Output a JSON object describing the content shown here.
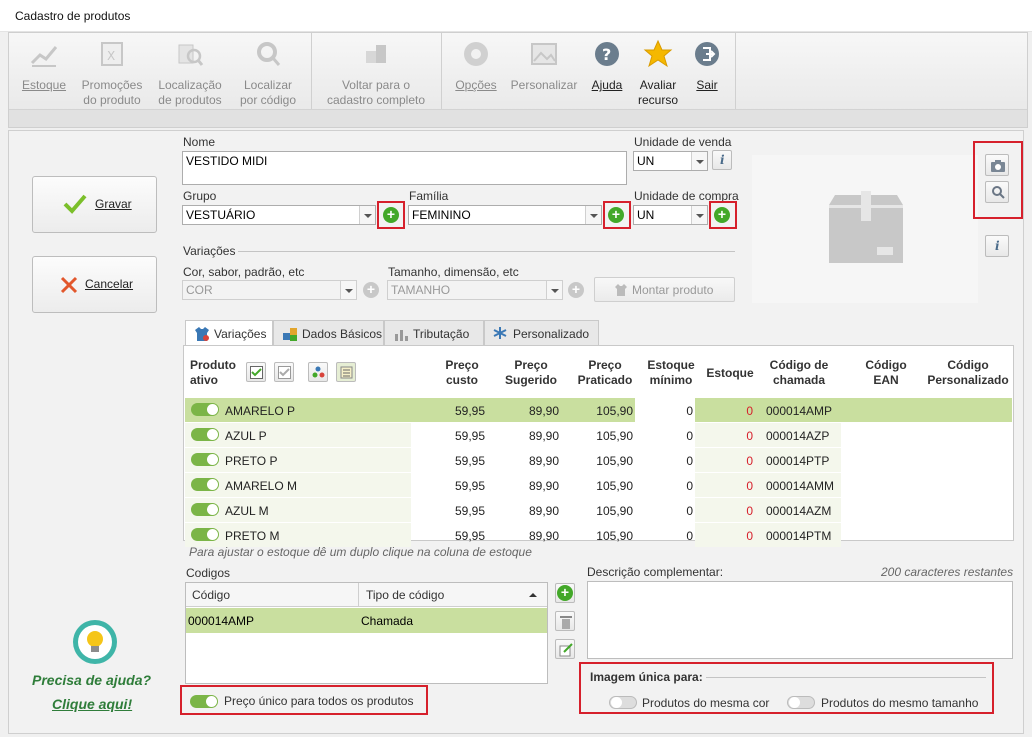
{
  "window": {
    "title": "Cadastro de produtos"
  },
  "toolbar": {
    "estoque": "Estoque",
    "promocoes_1": "Promoções",
    "promocoes_2": "do produto",
    "localizacao_1": "Localização",
    "localizacao_2": "de produtos",
    "localizar_1": "Localizar",
    "localizar_2": "por código",
    "voltar_1": "Voltar para o",
    "voltar_2": "cadastro completo",
    "opcoes": "Opções",
    "personalizar": "Personalizar",
    "ajuda": "Ajuda",
    "avaliar_1": "Avaliar",
    "avaliar_2": "recurso",
    "sair": "Sair"
  },
  "actions": {
    "gravar": "Gravar",
    "cancelar": "Cancelar"
  },
  "form": {
    "nome_label": "Nome",
    "nome_value": "VESTIDO MIDI",
    "unidade_venda_label": "Unidade de venda",
    "unidade_venda_value": "UN",
    "grupo_label": "Grupo",
    "grupo_value": "VESTUÁRIO",
    "familia_label": "Família",
    "familia_value": "FEMININO",
    "unidade_compra_label": "Unidade de compra",
    "unidade_compra_value": "UN",
    "variacoes_label": "Variações",
    "cor_label": "Cor, sabor, padrão, etc",
    "cor_value": "COR",
    "tamanho_label": "Tamanho, dimensão, etc",
    "tamanho_value": "TAMANHO",
    "montar_label": "Montar produto"
  },
  "tabs": [
    "Variações",
    "Dados Básicos",
    "Tributação",
    "Personalizado"
  ],
  "grid": {
    "headers": {
      "produto_1": "Produto",
      "produto_2": "ativo",
      "custo_1": "Preço",
      "custo_2": "custo",
      "sugerido_1": "Preço",
      "sugerido_2": "Sugerido",
      "praticado_1": "Preço",
      "praticado_2": "Praticado",
      "minimo_1": "Estoque",
      "minimo_2": "mínimo",
      "estoque": "Estoque",
      "chamada_1": "Código de",
      "chamada_2": "chamada",
      "ean_1": "Código",
      "ean_2": "EAN",
      "pers_1": "Código",
      "pers_2": "Personalizado"
    },
    "rows": [
      {
        "name": "AMARELO P",
        "custo": "59,95",
        "sugerido": "89,90",
        "praticado": "105,90",
        "minimo": "0",
        "estoque": "0",
        "codigo": "000014AMP"
      },
      {
        "name": "AZUL P",
        "custo": "59,95",
        "sugerido": "89,90",
        "praticado": "105,90",
        "minimo": "0",
        "estoque": "0",
        "codigo": "000014AZP"
      },
      {
        "name": "PRETO P",
        "custo": "59,95",
        "sugerido": "89,90",
        "praticado": "105,90",
        "minimo": "0",
        "estoque": "0",
        "codigo": "000014PTP"
      },
      {
        "name": "AMARELO M",
        "custo": "59,95",
        "sugerido": "89,90",
        "praticado": "105,90",
        "minimo": "0",
        "estoque": "0",
        "codigo": "000014AMM"
      },
      {
        "name": "AZUL M",
        "custo": "59,95",
        "sugerido": "89,90",
        "praticado": "105,90",
        "minimo": "0",
        "estoque": "0",
        "codigo": "000014AZM"
      },
      {
        "name": "PRETO M",
        "custo": "59,95",
        "sugerido": "89,90",
        "praticado": "105,90",
        "minimo": "0",
        "estoque": "0",
        "codigo": "000014PTM"
      }
    ],
    "hint": "Para ajustar o estoque dê um duplo clique na coluna de estoque"
  },
  "codigos": {
    "label": "Codigos",
    "col_codigo": "Código",
    "col_tipo": "Tipo de código",
    "row_codigo": "000014AMP",
    "row_tipo": "Chamada"
  },
  "descricao": {
    "label": "Descrição complementar:",
    "remaining": "200  caracteres restantes"
  },
  "preco_unico": "Preço único para todos os produtos",
  "imagem": {
    "title": "Imagem única para:",
    "mesma_cor": "Produtos do mesma cor",
    "mesmo_tamanho": "Produtos do mesmo tamanho"
  },
  "help": {
    "line1": "Precisa de ajuda?",
    "line2": "Clique aqui!"
  },
  "colors": {
    "accent_green": "#43a829",
    "highlight": "#d6202c",
    "row_selected": "#c9df9f",
    "help_text": "#2f7d3a"
  }
}
